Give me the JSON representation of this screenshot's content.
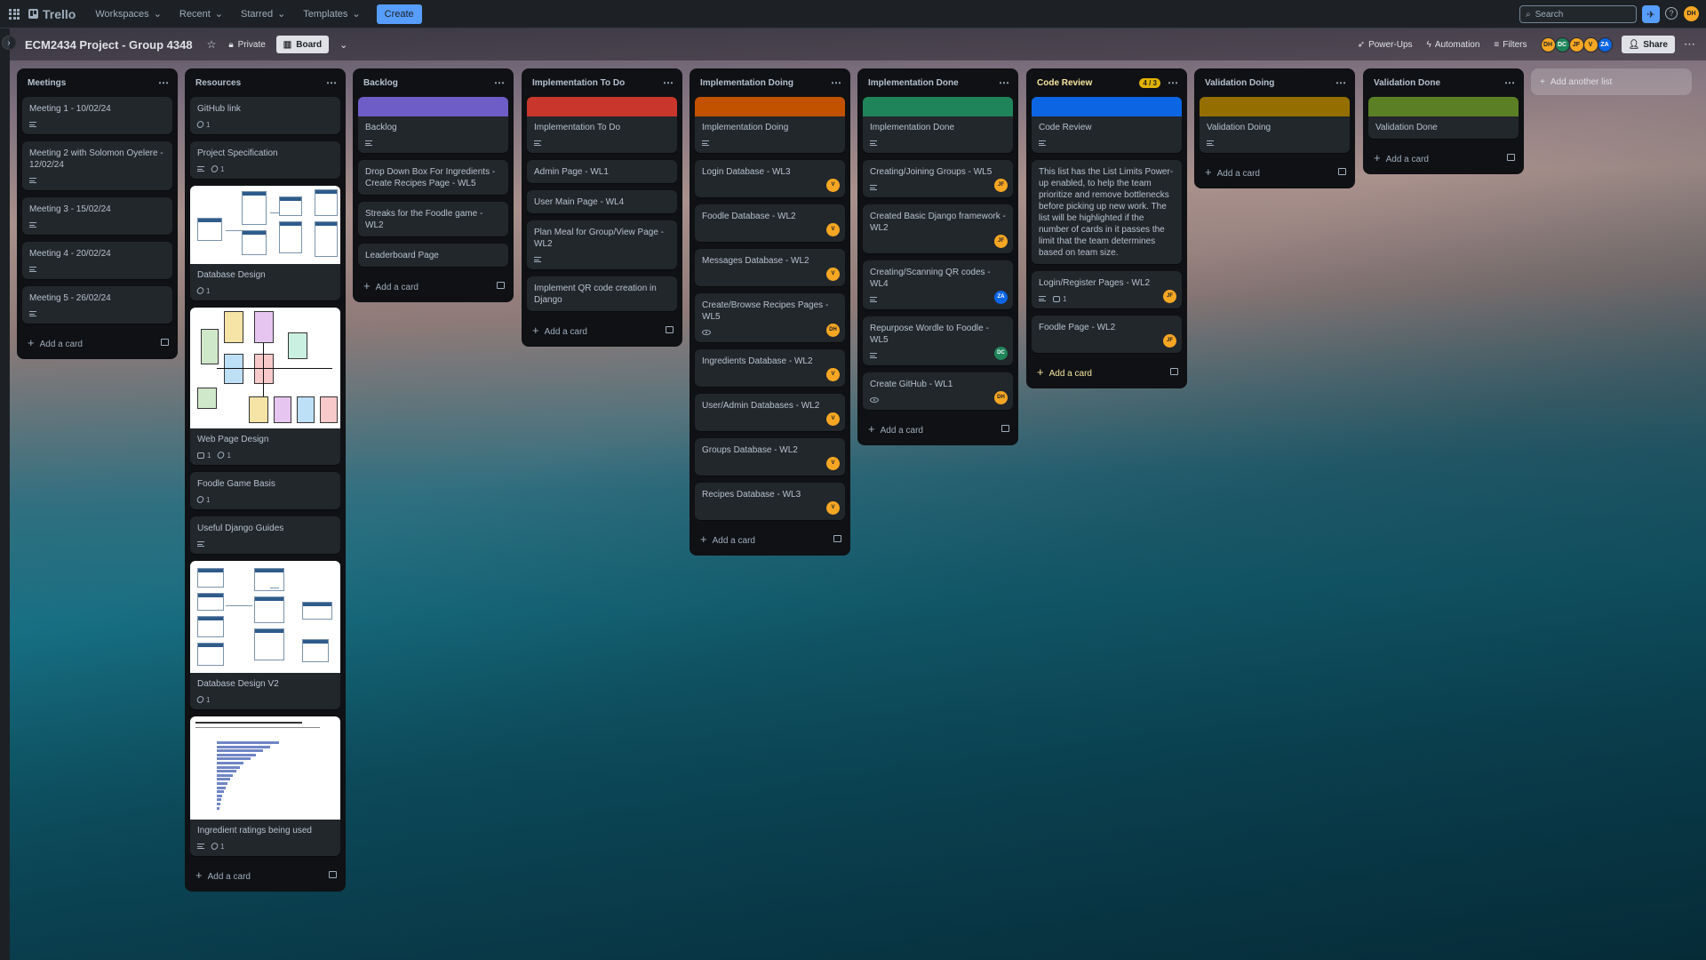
{
  "nav": {
    "app_name": "Trello",
    "menus": [
      "Workspaces",
      "Recent",
      "Starred",
      "Templates"
    ],
    "create_label": "Create",
    "search_placeholder": "Search",
    "user_initials": "DH"
  },
  "board": {
    "title": "ECM2434 Project - Group 4348",
    "visibility": "Private",
    "view_label": "Board",
    "powerups_label": "Power-Ups",
    "automation_label": "Automation",
    "filters_label": "Filters",
    "members": [
      "DH",
      "DC",
      "JF",
      "V",
      "ZA"
    ],
    "share_label": "Share",
    "add_list_label": "Add another list",
    "add_card_label": "Add a card"
  },
  "lists": [
    {
      "title": "Meetings",
      "cards": [
        {
          "title": "Meeting 1 - 10/02/24",
          "desc": true
        },
        {
          "title": "Meeting 2 with Solomon Oyelere - 12/02/24",
          "desc": true
        },
        {
          "title": "Meeting 3 - 15/02/24",
          "desc": true
        },
        {
          "title": "Meeting 4 - 20/02/24",
          "desc": true
        },
        {
          "title": "Meeting 5 - 26/02/24",
          "desc": true
        }
      ]
    },
    {
      "title": "Resources",
      "cards": [
        {
          "title": "GitHub link",
          "attachments": "1"
        },
        {
          "title": "Project Specification",
          "desc": true,
          "attachments": "1"
        },
        {
          "title": "Database Design",
          "attachments": "1",
          "image": "db"
        },
        {
          "title": "Web Page Design",
          "comments": "1",
          "attachments": "1",
          "image": "web"
        },
        {
          "title": "Foodle Game Basis",
          "attachments": "1"
        },
        {
          "title": "Useful Django Guides",
          "desc": true
        },
        {
          "title": "Database Design V2",
          "attachments": "1",
          "image": "db2"
        },
        {
          "title": "Ingredient ratings being used",
          "desc": true,
          "attachments": "1",
          "image": "chart"
        }
      ]
    },
    {
      "title": "Backlog",
      "cards": [
        {
          "title": "Backlog",
          "desc": true,
          "cover": "#6e5dc6"
        },
        {
          "title": "Drop Down Box For Ingredients - Create Recipes Page - WL5"
        },
        {
          "title": "Streaks for the Foodle game - WL2"
        },
        {
          "title": "Leaderboard Page"
        }
      ]
    },
    {
      "title": "Implementation To Do",
      "cards": [
        {
          "title": "Implementation To Do",
          "desc": true,
          "cover": "#c9372c"
        },
        {
          "title": "Admin Page - WL1"
        },
        {
          "title": "User Main Page - WL4"
        },
        {
          "title": "Plan Meal for Group/View Page - WL2",
          "desc": true
        },
        {
          "title": "Implement QR code creation in Django"
        }
      ]
    },
    {
      "title": "Implementation Doing",
      "cards": [
        {
          "title": "Implementation Doing",
          "desc": true,
          "cover": "#c25100"
        },
        {
          "title": "Login Database - WL3",
          "member": "V"
        },
        {
          "title": "Foodle Database - WL2",
          "member": "V"
        },
        {
          "title": "Messages Database - WL2",
          "member": "V"
        },
        {
          "title": "Create/Browse Recipes Pages - WL5",
          "watch": true,
          "member": "DH"
        },
        {
          "title": "Ingredients Database - WL2",
          "member": "V"
        },
        {
          "title": "User/Admin Databases - WL2",
          "member": "V"
        },
        {
          "title": "Groups Database - WL2",
          "member": "V"
        },
        {
          "title": "Recipes Database - WL3",
          "member": "V"
        }
      ]
    },
    {
      "title": "Implementation Done",
      "cards": [
        {
          "title": "Implementation Done",
          "desc": true,
          "cover": "#1f845a"
        },
        {
          "title": "Creating/Joining Groups - WL5",
          "desc": true,
          "member": "JF"
        },
        {
          "title": "Created Basic Django framework - WL2",
          "member": "JF"
        },
        {
          "title": "Creating/Scanning QR codes - WL4",
          "desc": true,
          "member": "ZA",
          "member_color": "blue"
        },
        {
          "title": "Repurpose Wordle to Foodle - WL5",
          "desc": true,
          "member": "DC",
          "member_color": "green"
        },
        {
          "title": "Create GitHub - WL1",
          "watch": true,
          "member": "DH"
        }
      ]
    },
    {
      "title": "Code Review",
      "limit": "4 / 3",
      "warn": true,
      "cards": [
        {
          "title": "Code Review",
          "desc": true,
          "cover": "#0c66e4"
        },
        {
          "title": "This list has the List Limits Power-up enabled, to help the team prioritize and remove bottlenecks before picking up new work. The list will be highlighted if the number of cards in it passes the limit that the team determines based on team size."
        },
        {
          "title": "Login/Register Pages - WL2",
          "desc": true,
          "comments": "1",
          "member": "JF"
        },
        {
          "title": "Foodle Page - WL2",
          "member": "JF"
        }
      ]
    },
    {
      "title": "Validation Doing",
      "cards": [
        {
          "title": "Validation Doing",
          "desc": true,
          "cover": "#946f00"
        }
      ]
    },
    {
      "title": "Validation Done",
      "cards": [
        {
          "title": "Validation Done",
          "cover": "#5b7f24"
        }
      ]
    }
  ]
}
